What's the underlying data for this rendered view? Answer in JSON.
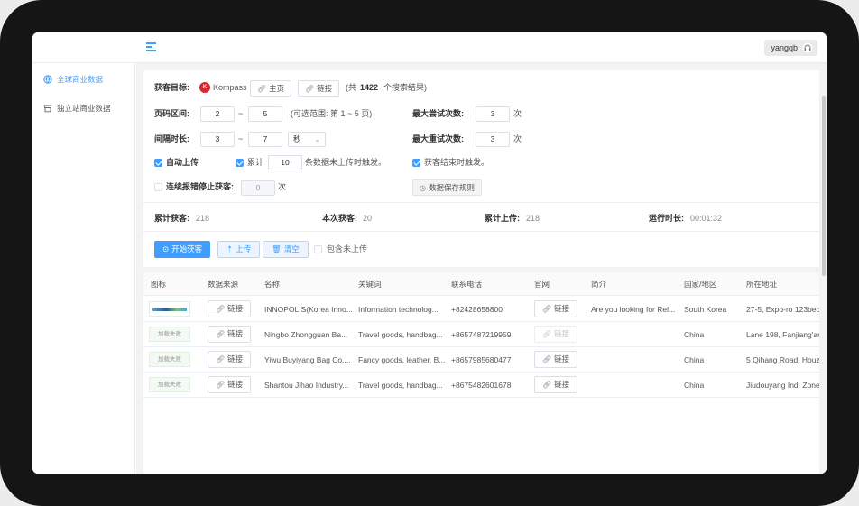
{
  "topbar": {
    "username": "yangqb",
    "menu_icon": "menu-fold-icon",
    "user_icon": "headset-icon"
  },
  "sidebar": {
    "items": [
      {
        "label": "全球商业数据",
        "icon": "globe-icon",
        "active": true
      },
      {
        "label": "独立站商业数据",
        "icon": "shop-icon",
        "active": false
      }
    ]
  },
  "form": {
    "target_label": "获客目标:",
    "source_name": "Kompass",
    "home_btn": "主页",
    "link_btn": "链接",
    "result_prefix": "(共",
    "result_count": "1422",
    "result_suffix": "个搜索结果)",
    "page_range_label": "页码区间:",
    "page_from": "2",
    "page_to": "5",
    "tilde": "~",
    "page_hint": "(可选范围: 第 1 ~ 5 页)",
    "max_try_label": "最大尝试次数:",
    "max_try_value": "3",
    "max_retry_label": "最大重试次数:",
    "max_retry_value": "3",
    "times_unit": "次",
    "interval_label": "间隔时长:",
    "interval_from": "3",
    "interval_to": "7",
    "interval_unit": "秒",
    "auto_upload_label": "自动上传",
    "accumulate_label": "累计",
    "accumulate_value": "10",
    "accumulate_suffix": "条数据未上传时触发。",
    "on_finish_label": "获客结束时触发。",
    "stop_on_error_label": "连续报错停止获客:",
    "stop_on_error_value": "0",
    "save_rules_btn": "数据保存规则"
  },
  "stats": {
    "total_label": "累计获客:",
    "total_value": "218",
    "this_label": "本次获客:",
    "this_value": "20",
    "uploaded_label": "累计上传:",
    "uploaded_value": "218",
    "runtime_label": "运行时长:",
    "runtime_value": "00:01:32"
  },
  "actions": {
    "start": "开始获客",
    "upload": "上传",
    "clear": "清空",
    "include_not_uploaded": "包含未上传"
  },
  "table": {
    "columns": [
      "图标",
      "数据来源",
      "名称",
      "关键词",
      "联系电话",
      "官网",
      "简介",
      "国家/地区",
      "所在地址"
    ],
    "link_label": "链接",
    "logo_failed": "加载失败",
    "rows": [
      {
        "logo": "image",
        "name": "INNOPOLIS(Korea Inno...",
        "keywords": "Information technolog...",
        "phone": "+82428658800",
        "website_enabled": true,
        "intro": "Are you looking for Rel...",
        "country": "South Korea",
        "address": "27-5, Expo-ro 123beon"
      },
      {
        "logo": "failed",
        "name": "Ningbo Zhongguan Ba...",
        "keywords": "Travel goods, handbag...",
        "phone": "+8657487219959",
        "website_enabled": false,
        "intro": "",
        "country": "China",
        "address": "Lane 198, Fanjiang'an ..."
      },
      {
        "logo": "failed",
        "name": "Yiwu Buyiyang Bag Co....",
        "keywords": "Fancy goods, leather, B...",
        "phone": "+8657985680477",
        "website_enabled": true,
        "intro": "",
        "country": "China",
        "address": "5 Qihang Road, Houzh..."
      },
      {
        "logo": "failed",
        "name": "Shantou Jihao Industry...",
        "keywords": "Travel goods, handbag...",
        "phone": "+8675482601678",
        "website_enabled": true,
        "intro": "",
        "country": "China",
        "address": "Jiudouyang Ind. Zone, ..."
      }
    ]
  },
  "colors": {
    "accent": "#409eff",
    "brand_kompass": "#d9272e"
  }
}
